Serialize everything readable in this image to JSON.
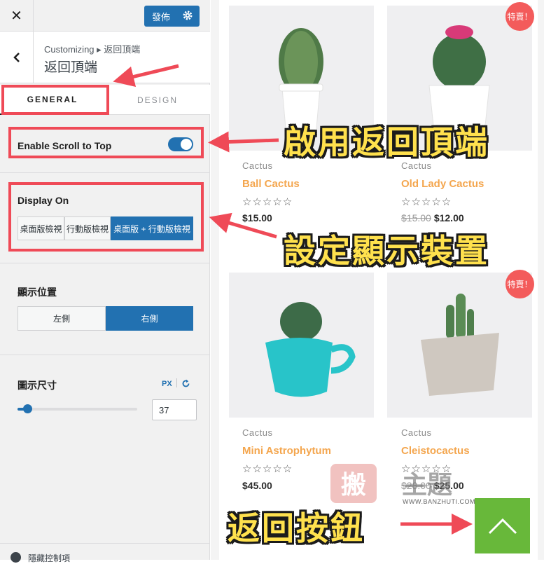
{
  "topbar": {
    "close": "✕",
    "publish_label": "發佈"
  },
  "section": {
    "breadcrumb": "Customizing ▸ 返回頂端",
    "title": "返回頂端"
  },
  "tabs": {
    "general": "GENERAL",
    "design": "DESIGN"
  },
  "scroll_top": {
    "label": "Enable Scroll to Top",
    "enabled": true
  },
  "display_on": {
    "label": "Display On",
    "options": [
      "桌面版檢視",
      "行動版檢視",
      "桌面版 + 行動版檢視"
    ],
    "selected": "桌面版 + 行動版檢視"
  },
  "position": {
    "label": "顯示位置",
    "options": [
      "左側",
      "右側"
    ],
    "selected": "右側"
  },
  "icon_size": {
    "label": "圖示尺寸",
    "unit": "PX",
    "value": "37",
    "slider_fraction": 0.08
  },
  "footer": {
    "label": "隱藏控制項"
  },
  "products": [
    {
      "category": "Cactus",
      "name": "Ball Cactus",
      "stars": "☆☆☆☆☆",
      "price": "$15.00",
      "old_price": "",
      "badge": ""
    },
    {
      "category": "Cactus",
      "name": "Old Lady Cactus",
      "stars": "☆☆☆☆☆",
      "price": "$12.00",
      "old_price": "$15.00",
      "badge": "特賣！"
    },
    {
      "category": "Cactus",
      "name": "Mini Astrophytum",
      "stars": "☆☆☆☆☆",
      "price": "$45.00",
      "old_price": "",
      "badge": ""
    },
    {
      "category": "Cactus",
      "name": "Cleistocactus",
      "stars": "☆☆☆☆☆",
      "price": "$25.00",
      "old_price": "$28.00",
      "badge": "特賣！"
    }
  ],
  "callouts": {
    "enable": "啟用返回頂端",
    "device": "設定顯示裝置",
    "button": "返回按鈕"
  },
  "watermark": {
    "url": "WWW.BANZHUTI.COM"
  },
  "colors": {
    "accent": "#2271b1",
    "annotation_red": "#ef4a57",
    "callout_yellow": "#ffe14d",
    "product_name": "#f4a64e",
    "sale_badge": "#f35b5b",
    "back_to_top": "#68b83a"
  }
}
